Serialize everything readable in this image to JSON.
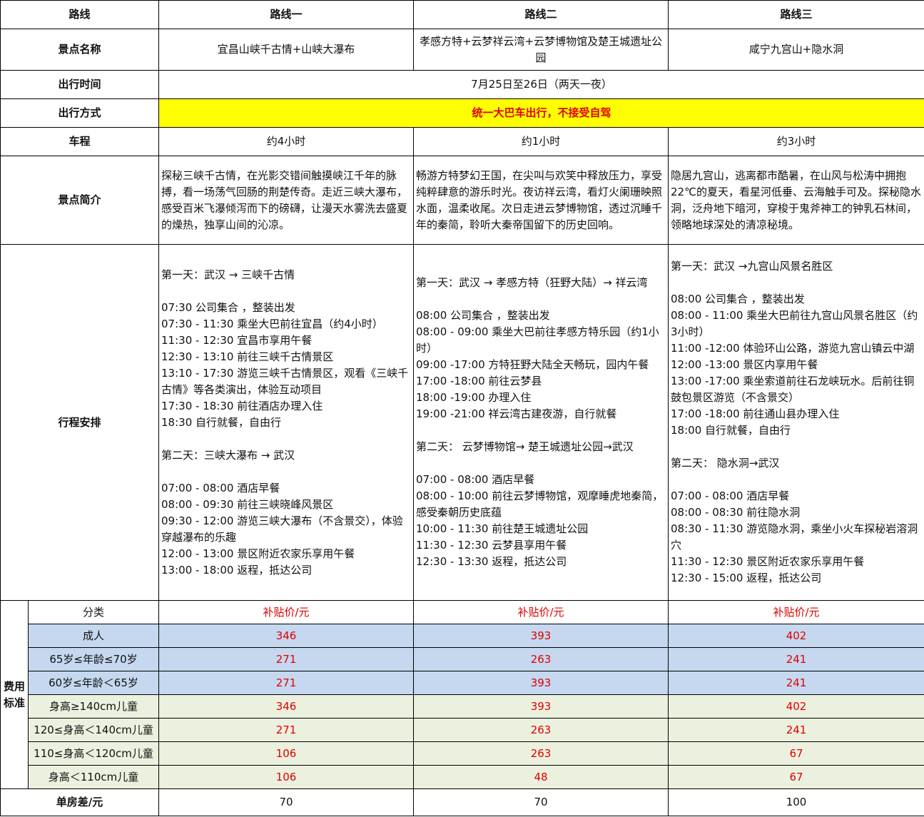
{
  "header": {
    "col0": "路线",
    "routes": [
      "路线一",
      "路线二",
      "路线三"
    ]
  },
  "rows": {
    "scenic": {
      "label": "景点名称",
      "values": [
        "宜昌山峡千古情+山峡大瀑布",
        "孝感方特+云梦祥云湾+云梦博物馆及楚王城遗址公园",
        "咸宁九宫山+隐水洞"
      ]
    },
    "date": {
      "label": "出行时间",
      "value": "7月25日至26日（两天一夜）"
    },
    "mode": {
      "label": "出行方式",
      "value": "统一大巴车出行，不接受自驾"
    },
    "drive": {
      "label": "车程",
      "values": [
        "约4小时",
        "约1小时",
        "约3小时"
      ]
    },
    "intro": {
      "label": "景点简介",
      "values": [
        "探秘三峡千古情，在光影交错间触摸峡江千年的脉搏，看一场荡气回肠的荆楚传奇。走近三峡大瀑布，感受百米飞瀑倾泻而下的磅礴，让漫天水雾洗去盛夏的燥热，独享山间的沁凉。",
        "畅游方特梦幻王国，在尖叫与欢笑中释放压力，享受纯粹肆意的游乐时光。夜访祥云湾，看灯火阑珊映照水面，温柔收尾。次日走进云梦博物馆，透过沉睡千年的秦简，聆听大秦帝国留下的历史回响。",
        "隐居九宫山，逃离都市酷暑，在山风与松涛中拥抱22℃的夏天，看星河低垂、云海触手可及。探秘隐水洞，泛舟地下暗河，穿梭于鬼斧神工的钟乳石林间，领略地球深处的清凉秘境。"
      ]
    },
    "itinerary": {
      "label": "行程安排",
      "routes": [
        [
          "第一天：武汉 → 三峡千古情",
          "",
          "07:30  公司集合 ，整装出发",
          "07:30 - 11:30  乘坐大巴前往宜昌（约4小时）",
          "11:30 - 12:30  宜昌市享用午餐",
          "12:30 - 13:10  前往三峡千古情景区",
          "13:10 - 17:30  游览三峡千古情景区，观看《三峡千古情》等各类演出，体验互动项目",
          "17:30 - 18:30  前往酒店办理入住",
          "18:30  自行就餐，自由行",
          "",
          "第二天：三峡大瀑布 → 武汉",
          "",
          "07:00 - 08:00  酒店早餐",
          "08:00 - 09:30  前往三峡晓峰风景区",
          "09:30 - 12:00  游览三峡大瀑布（不含景交），体验穿越瀑布的乐趣",
          "12:00 - 13:00  景区附近农家乐享用午餐",
          "13:00 - 18:00  返程，抵达公司"
        ],
        [
          "第一天：武汉 → 孝感方特（狂野大陆）→ 祥云湾",
          "",
          "08:00  公司集合 ，整装出发",
          "08:00 - 09:00 乘坐大巴前往孝感方特乐园（约1小时）",
          "09:00 -17:00 方特狂野大陆全天畅玩，园内午餐",
          "17:00 -18:00 前往云梦县",
          "18:00 -19:00 办理入住",
          "19:00 -21:00 祥云湾古建夜游，自行就餐",
          "",
          "第二天：  云梦博物馆→ 楚王城遗址公园→武汉",
          "",
          "07:00 - 08:00  酒店早餐",
          "08:00 - 10:00  前往云梦博物馆，观摩睡虎地秦简，感受秦朝历史底蕴",
          "10:00 - 11:30  前往楚王城遗址公园",
          "11:30 - 12:30  云梦县享用午餐",
          "12:30 - 13:30  返程，抵达公司"
        ],
        [
          "第一天：武汉 →九宫山风景名胜区",
          "",
          "08:00  公司集合 ，整装出发",
          "08:00 - 11:00 乘坐大巴前往九宫山风景名胜区（约3小时）",
          "11:00 -12:00 体验环山公路，游览九宫山镇云中湖",
          "12:00 -13:00 景区内享用午餐",
          "13:00 -17:00 乘坐索道前往石龙峡玩水。后前往铜鼓包景区游览（不含景交）",
          "17:00 -18:00 前往通山县办理入住",
          "18:00  自行就餐，自由行",
          "",
          "第二天：  隐水洞→武汉",
          "",
          "07:00 - 08:00  酒店早餐",
          "08:00 - 08:30  前往隐水洞",
          "08:30 - 11:30  游览隐水洞，乘坐小火车探秘岩溶洞穴",
          "11:30 - 12:30  景区附近农家乐享用午餐",
          "12:30 - 15:00  返程，抵达公司"
        ]
      ]
    },
    "fees": {
      "label": "费用标准",
      "category_label": "分类",
      "price_header": "补贴价/元",
      "items": [
        {
          "name": "成人",
          "values": [
            "346",
            "393",
            "402"
          ],
          "band": "blue"
        },
        {
          "name": "65岁≤年龄≤70岁",
          "values": [
            "271",
            "263",
            "241"
          ],
          "band": "blue"
        },
        {
          "name": "60岁≤年龄＜65岁",
          "values": [
            "271",
            "393",
            "241"
          ],
          "band": "blue"
        },
        {
          "name": "身高≥140cm儿童",
          "values": [
            "346",
            "393",
            "402"
          ],
          "band": "green"
        },
        {
          "name": "120≤身高＜140cm儿童",
          "values": [
            "271",
            "263",
            "241"
          ],
          "band": "green"
        },
        {
          "name": "110≤身高＜120cm儿童",
          "values": [
            "106",
            "263",
            "67"
          ],
          "band": "green"
        },
        {
          "name": "身高＜110cm儿童",
          "values": [
            "106",
            "48",
            "67"
          ],
          "band": "green"
        }
      ]
    },
    "single": {
      "label": "单房差/元",
      "values": [
        "70",
        "70",
        "100"
      ]
    }
  },
  "colors": {
    "highlight": "#ffff00",
    "price_red": "#e00000",
    "band_blue": "#c5d8ef",
    "band_green": "#ebf1de"
  }
}
